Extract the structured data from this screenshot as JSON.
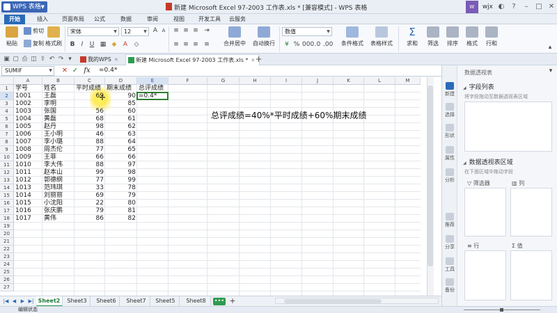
{
  "window": {
    "app_name": "WPS 表格",
    "title": "新建 Microsoft Excel 97-2003 工作表.xls * [兼容模式] - WPS 表格",
    "user_name": "wjx"
  },
  "menu_tabs": [
    "开始",
    "插入",
    "页面布局",
    "公式",
    "数据",
    "审阅",
    "视图",
    "开发工具",
    "云服务"
  ],
  "ribbon": {
    "paste": "粘贴",
    "cut": "剪切",
    "copy": "复制",
    "format_painter": "格式刷",
    "font_name": "宋体",
    "font_size": "12",
    "merge_center": "合并居中",
    "wrap_text": "自动换行",
    "number_format": "数值",
    "conditional_format": "条件格式",
    "table_style": "表格样式",
    "sum": "求和",
    "filter": "筛选",
    "sort": "排序",
    "format": "格式",
    "row_col": "行和"
  },
  "doc_tabs": [
    {
      "label": "我的WPS"
    },
    {
      "label": "新建 Microsoft Excel 97-2003 工作表.xls *"
    }
  ],
  "formula_bar": {
    "name_box": "SUMIF",
    "cancel": "✕",
    "confirm": "✓",
    "fx": "fx",
    "formula": "=0.4*"
  },
  "columns": [
    "A",
    "B",
    "C",
    "D",
    "E",
    "F",
    "G",
    "H",
    "I",
    "J",
    "K",
    "L",
    "M"
  ],
  "row_numbers": [
    "1",
    "2",
    "3",
    "4",
    "5",
    "6",
    "7",
    "8",
    "9",
    "10",
    "11",
    "12",
    "13",
    "14",
    "15",
    "16",
    "17",
    "18",
    "19",
    "20",
    "21",
    "22",
    "23",
    "24",
    "25",
    "26",
    "27"
  ],
  "header_row": [
    "学号",
    "姓名",
    "平时成绩",
    "期末成绩",
    "总评成绩"
  ],
  "rows": [
    [
      "1001",
      "王磊",
      "69",
      "90",
      "=0.4*"
    ],
    [
      "1002",
      "李明",
      "",
      "85",
      ""
    ],
    [
      "1003",
      "张国",
      "56",
      "60",
      ""
    ],
    [
      "1004",
      "黄磊",
      "68",
      "61",
      ""
    ],
    [
      "1005",
      "赵丹",
      "98",
      "62",
      ""
    ],
    [
      "1006",
      "王小明",
      "46",
      "63",
      ""
    ],
    [
      "1007",
      "李小璐",
      "88",
      "64",
      ""
    ],
    [
      "1008",
      "周杰伦",
      "77",
      "65",
      ""
    ],
    [
      "1009",
      "王菲",
      "66",
      "66",
      ""
    ],
    [
      "1010",
      "李大伟",
      "88",
      "97",
      ""
    ],
    [
      "1011",
      "赵本山",
      "99",
      "98",
      ""
    ],
    [
      "1012",
      "郭德纲",
      "77",
      "99",
      ""
    ],
    [
      "1013",
      "范玮琪",
      "33",
      "78",
      ""
    ],
    [
      "1014",
      "刘丽丽",
      "69",
      "79",
      ""
    ],
    [
      "1015",
      "小沈阳",
      "22",
      "80",
      ""
    ],
    [
      "1016",
      "张庆鹏",
      "79",
      "81",
      ""
    ],
    [
      "1017",
      "黄伟",
      "86",
      "82",
      ""
    ]
  ],
  "note": "总评成绩=40%*平时成绩+60%期末成绩",
  "sheet_tabs": [
    "Sheet2",
    "Sheet3",
    "Sheet6",
    "Sheet7",
    "Sheet5",
    "Sheet8"
  ],
  "sheet_more": "•••",
  "status": {
    "mode": "编辑状态"
  },
  "pivot_pane": {
    "title": "数据透视表",
    "field_list": "字段列表",
    "field_list_hint": "将字段拖动至数据透视表区域",
    "area": "数据透视表区域",
    "area_hint": "在下面区域中拖动字段",
    "filter": "筛选器",
    "columns": "列",
    "rows": "行",
    "values": "值"
  },
  "pane_sidebar": [
    "新建",
    "选择",
    "形状",
    "属性",
    "分析",
    "推荐",
    "分享",
    "工具",
    "备份"
  ],
  "colors": {
    "accent": "#2b6ab7",
    "active_cell": "#2e7d32",
    "highlight": "#ffe95a"
  }
}
